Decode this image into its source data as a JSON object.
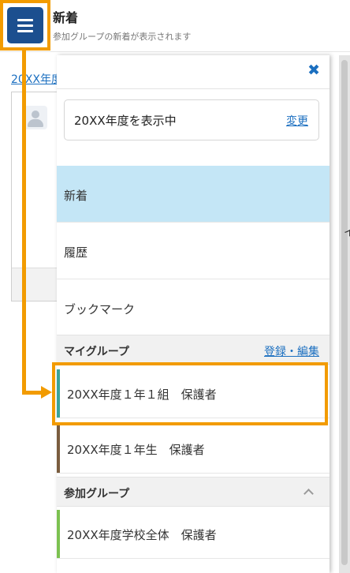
{
  "header": {
    "title": "新着",
    "subtitle": "参加グループの新着が表示されます"
  },
  "background": {
    "link_text": "20XX年度"
  },
  "drawer": {
    "year_display": "20XX年度を表示中",
    "change_label": "変更",
    "nav_items": [
      {
        "label": "新着",
        "active": true
      },
      {
        "label": "履歴",
        "active": false
      },
      {
        "label": "ブックマーク",
        "active": false
      }
    ],
    "my_groups": {
      "title": "マイグループ",
      "edit_label": "登録・編集",
      "items": [
        {
          "label": "20XX年度１年１組　保護者",
          "color": "#3aa39a"
        },
        {
          "label": "20XX年度１年生　保護者",
          "color": "#7a5c3e"
        }
      ]
    },
    "joined_groups": {
      "title": "参加グループ",
      "items": [
        {
          "label": "20XX年度学校全体　保護者",
          "color": "#7cc150"
        }
      ]
    }
  },
  "colors": {
    "accent": "#1b6fc0",
    "menu_button": "#1c4f8f",
    "active_nav": "#c4e6f6",
    "annotation": "#f29b00"
  },
  "icons": {
    "menu": "hamburger-menu-icon",
    "close": "close-icon",
    "avatar": "user-avatar-icon",
    "collapse": "chevron-up-icon"
  }
}
